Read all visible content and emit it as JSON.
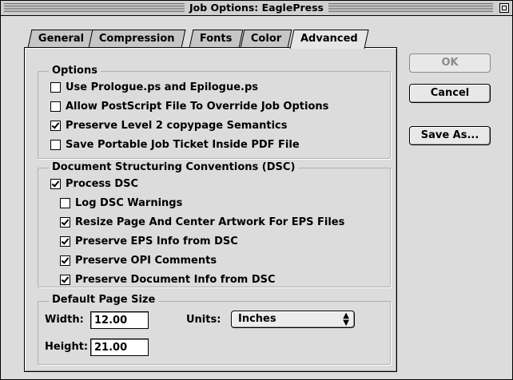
{
  "window": {
    "title": "Job Options: EaglePress"
  },
  "tabs": [
    {
      "label": "General"
    },
    {
      "label": "Compression"
    },
    {
      "label": "Fonts"
    },
    {
      "label": "Color"
    },
    {
      "label": "Advanced"
    }
  ],
  "active_tab": "Advanced",
  "options": {
    "title": "Options",
    "items": [
      {
        "label": "Use Prologue.ps and Epilogue.ps",
        "checked": false
      },
      {
        "label": "Allow PostScript File To Override Job Options",
        "checked": false
      },
      {
        "label": "Preserve Level 2 copypage Semantics",
        "checked": true
      },
      {
        "label": "Save Portable Job Ticket Inside PDF File",
        "checked": false
      }
    ]
  },
  "dsc": {
    "title": "Document Structuring Conventions (DSC)",
    "process": {
      "label": "Process DSC",
      "checked": true
    },
    "items": [
      {
        "label": "Log DSC Warnings",
        "checked": false
      },
      {
        "label": "Resize Page And Center Artwork For EPS Files",
        "checked": true
      },
      {
        "label": "Preserve EPS Info from DSC",
        "checked": true
      },
      {
        "label": "Preserve OPI Comments",
        "checked": true
      },
      {
        "label": "Preserve Document Info from DSC",
        "checked": true
      }
    ]
  },
  "page_size": {
    "title": "Default Page Size",
    "width_label": "Width:",
    "width_value": "12.00",
    "height_label": "Height:",
    "height_value": "21.00",
    "units_label": "Units:",
    "units_value": "Inches"
  },
  "buttons": {
    "ok": "OK",
    "cancel": "Cancel",
    "save_as": "Save As..."
  }
}
